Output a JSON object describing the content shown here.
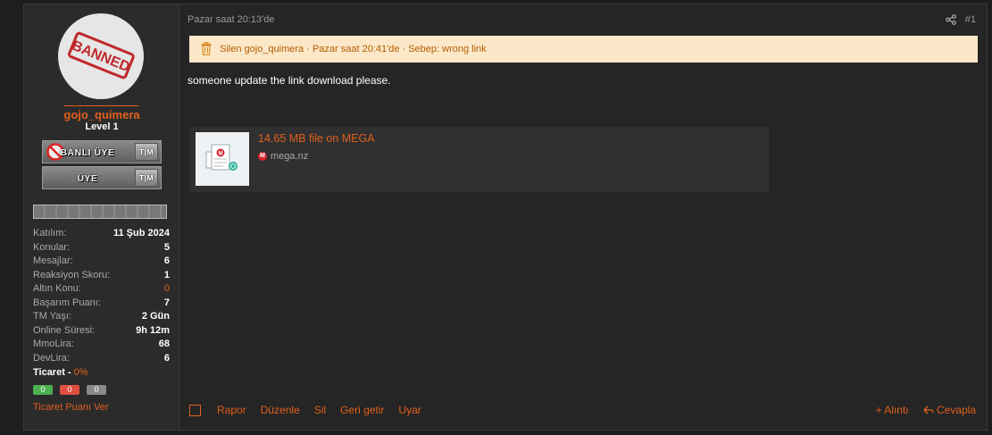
{
  "user": {
    "username": "gojo_quimera",
    "level": "Level 1",
    "avatar_icon": "banned-stamp-avatar",
    "avatar_text": "BANNED",
    "ranks": [
      {
        "label": "BANLI ÜYE",
        "tag": "T|M",
        "icon": "no-entry-icon"
      },
      {
        "label": "ÜYE",
        "tag": "T|M"
      }
    ],
    "stats": [
      {
        "key": "Katılım:",
        "value": "11 Şub 2024"
      },
      {
        "key": "Konular:",
        "value": "5"
      },
      {
        "key": "Mesajlar:",
        "value": "6"
      },
      {
        "key": "Reaksiyon Skoru:",
        "value": "1"
      },
      {
        "key": "Altın Konu:",
        "value": "0"
      },
      {
        "key": "Başarım Puanı:",
        "value": "7"
      },
      {
        "key": "TM Yaşı:",
        "value": "2 Gün"
      },
      {
        "key": "Online Süresi:",
        "value": "9h 12m"
      },
      {
        "key": "MmoLira:",
        "value": "68"
      },
      {
        "key": "DevLira:",
        "value": "6"
      }
    ],
    "trade": {
      "label": "Ticaret -",
      "percent": "0%",
      "positive": "0",
      "negative": "0",
      "neutral": "0",
      "link": "Ticaret Puanı Ver"
    }
  },
  "post": {
    "date": "Pazar saat 20:13'de",
    "number": "#1",
    "deleted_notice": "Silen gojo_quimera · Pazar saat 20:41'de · Sebep: wrong link",
    "message": "someone update the link download please.",
    "embed": {
      "title": "14.65 MB file on MEGA",
      "site": "mega.nz"
    }
  },
  "actions": {
    "left": [
      "Rapor",
      "Düzenle",
      "Sil",
      "Geri getir",
      "Uyar"
    ],
    "quote": "+ Alıntı",
    "reply": "Cevapla"
  },
  "colors": {
    "accent": "#e0601c",
    "notice_bg": "#fce8c8",
    "positive": "#4caf50",
    "negative": "#e05040",
    "neutral": "#8a8a8a"
  }
}
